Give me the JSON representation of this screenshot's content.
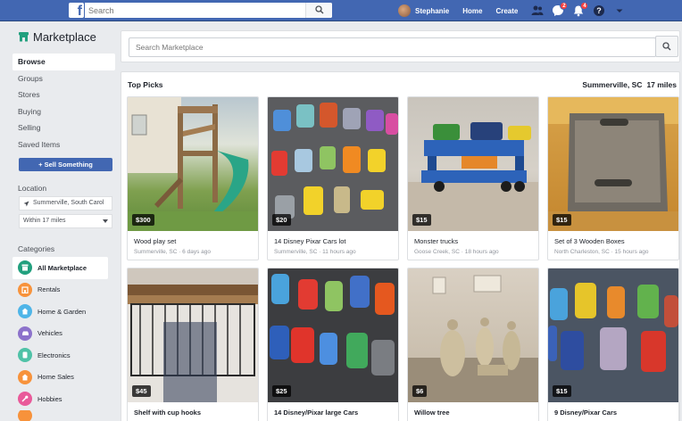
{
  "topbar": {
    "logo": "f",
    "search_placeholder": "Search",
    "user_name": "Stephanie",
    "home": "Home",
    "create": "Create",
    "messages_badge": "2",
    "notifications_badge": "4"
  },
  "sidebar": {
    "title": "Marketplace",
    "nav": [
      "Browse",
      "Groups",
      "Stores",
      "Buying",
      "Selling",
      "Saved Items"
    ],
    "sell_button": "+ Sell Something",
    "location_label": "Location",
    "location_value": "Summerville, South Carol",
    "radius_value": "Within 17 miles",
    "categories_label": "Categories",
    "categories": [
      {
        "label": "All Marketplace",
        "color": "#8d949e",
        "icon": "storefront-icon"
      },
      {
        "label": "Rentals",
        "color": "#f7923b",
        "icon": "rentals-icon"
      },
      {
        "label": "Home & Garden",
        "color": "#4fb5e8",
        "icon": "home-icon"
      },
      {
        "label": "Vehicles",
        "color": "#8c72cb",
        "icon": "car-icon"
      },
      {
        "label": "Electronics",
        "color": "#4fc2a7",
        "icon": "electronics-icon"
      },
      {
        "label": "Home Sales",
        "color": "#f7923b",
        "icon": "home-sales-icon"
      },
      {
        "label": "Hobbies",
        "color": "#e95a9a",
        "icon": "hobbies-icon"
      }
    ]
  },
  "main": {
    "search_placeholder": "Search Marketplace",
    "section_title": "Top Picks",
    "location": "Summerville, SC",
    "distance": "17 miles",
    "listings": [
      {
        "price": "$300",
        "title": "Wood play set",
        "meta": "Summerville, SC · 6 days ago"
      },
      {
        "price": "$20",
        "title": "14 Disney Pixar Cars lot",
        "meta": "Summerville, SC · 11 hours ago"
      },
      {
        "price": "$15",
        "title": "Monster trucks",
        "meta": "Goose Creek, SC · 18 hours ago"
      },
      {
        "price": "$15",
        "title": "Set of 3 Wooden Boxes",
        "meta": "North Charleston, SC · 15 hours ago"
      },
      {
        "price": "$45",
        "title": "Shelf with cup hooks",
        "meta": ""
      },
      {
        "price": "$25",
        "title": "14 Disney/Pixar large Cars",
        "meta": ""
      },
      {
        "price": "$6",
        "title": "Willow tree",
        "meta": ""
      },
      {
        "price": "$15",
        "title": "9 Disney/Pixar Cars",
        "meta": ""
      }
    ]
  }
}
